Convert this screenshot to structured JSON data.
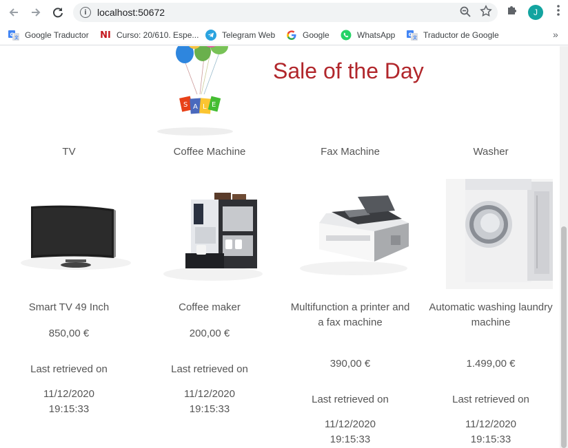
{
  "browser": {
    "url": "localhost:50672",
    "avatar_letter": "J",
    "bookmarks": [
      {
        "label": "Google Traductor",
        "icon": "translate-icon",
        "color": "#4285f4"
      },
      {
        "label": "Curso: 20/610. Espe...",
        "icon": "ni-logo-icon",
        "color": "#c4161c"
      },
      {
        "label": "Telegram Web",
        "icon": "telegram-icon",
        "color": "#2aa3df"
      },
      {
        "label": "Google",
        "icon": "google-icon",
        "color": "#4285f4"
      },
      {
        "label": "WhatsApp",
        "icon": "whatsapp-icon",
        "color": "#25d366"
      },
      {
        "label": "Traductor de Google",
        "icon": "translate-icon",
        "color": "#4285f4"
      }
    ]
  },
  "page": {
    "title": "Sale of the Day",
    "title_color": "#b1262b",
    "products": [
      {
        "name": "TV",
        "image": "tv-icon",
        "description": "Smart TV 49 Inch",
        "price": "850,00 €",
        "retrieved_label": "Last retrieved on",
        "date": "11/12/2020",
        "time": "19:15:33"
      },
      {
        "name": "Coffee Machine",
        "image": "coffee-machine-icon",
        "description": "Coffee maker",
        "price": "200,00 €",
        "retrieved_label": "Last retrieved on",
        "date": "11/12/2020",
        "time": "19:15:33"
      },
      {
        "name": "Fax Machine",
        "image": "fax-machine-icon",
        "description": "Multifunction a printer and a fax machine",
        "price": "390,00 €",
        "retrieved_label": "Last retrieved on",
        "date": "11/12/2020",
        "time": "19:15:33"
      },
      {
        "name": "Washer",
        "image": "washer-icon",
        "description": "Automatic washing laundry machine",
        "price": "1.499,00 €",
        "retrieved_label": "Last retrieved on",
        "date": "11/12/2020",
        "time": "19:15:33"
      }
    ]
  }
}
